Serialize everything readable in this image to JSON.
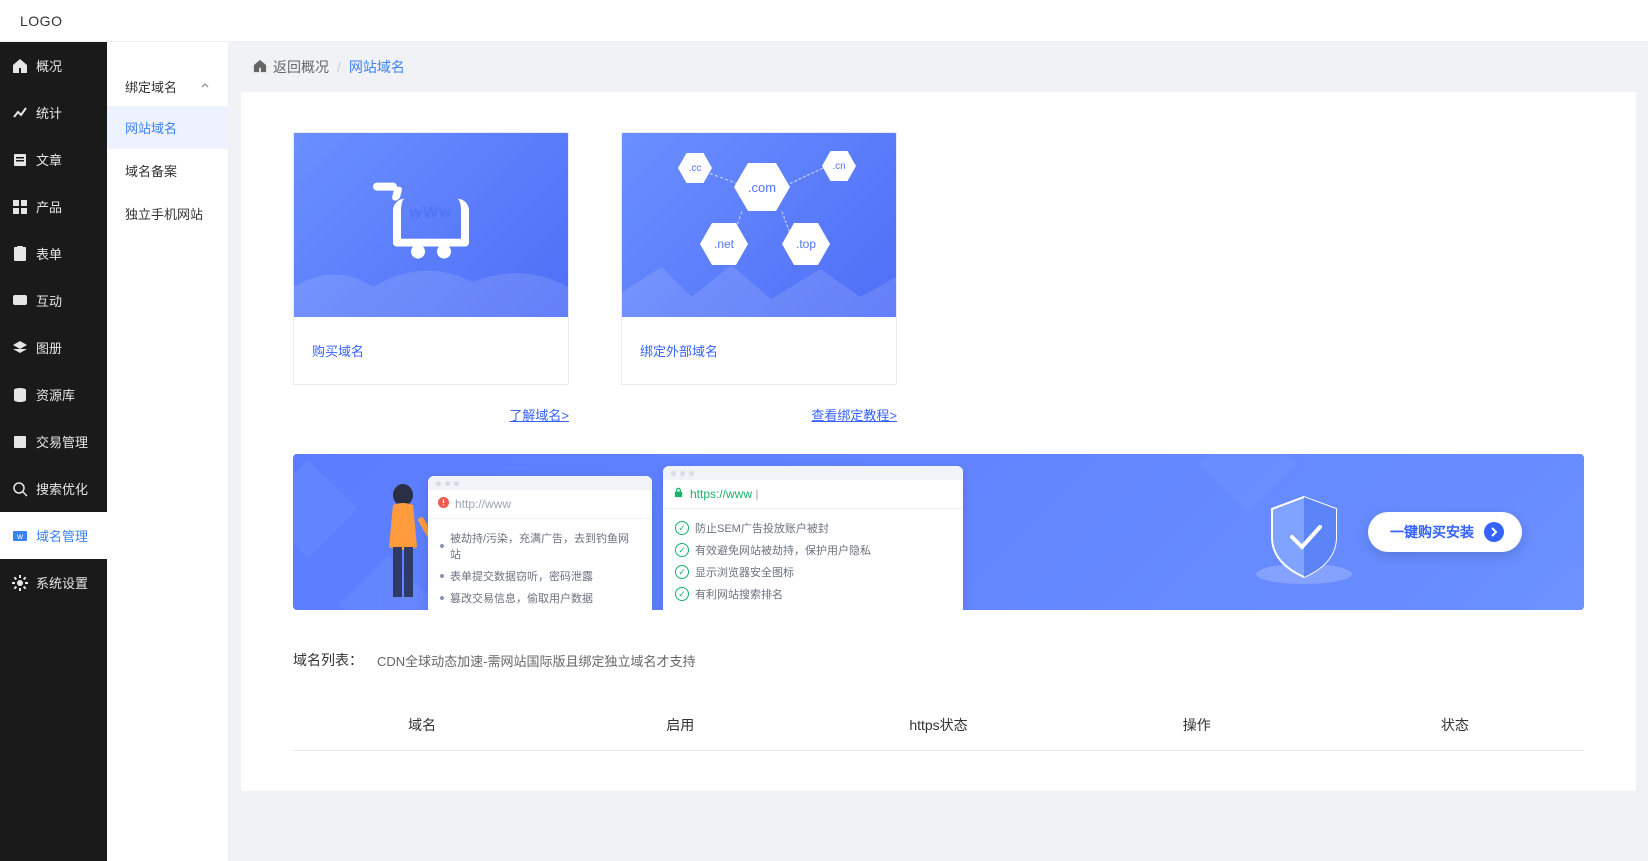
{
  "header": {
    "logo": "LOGO"
  },
  "sidebar": {
    "items": [
      {
        "label": "概况",
        "icon": "home"
      },
      {
        "label": "统计",
        "icon": "chart"
      },
      {
        "label": "文章",
        "icon": "doc"
      },
      {
        "label": "产品",
        "icon": "grid"
      },
      {
        "label": "表单",
        "icon": "form"
      },
      {
        "label": "互动",
        "icon": "chat"
      },
      {
        "label": "图册",
        "icon": "layers"
      },
      {
        "label": "资源库",
        "icon": "db"
      },
      {
        "label": "交易管理",
        "icon": "trade"
      },
      {
        "label": "搜索优化",
        "icon": "seo"
      },
      {
        "label": "域名管理",
        "icon": "domain",
        "active": true
      },
      {
        "label": "系统设置",
        "icon": "gear"
      }
    ]
  },
  "subSidebar": {
    "header": "绑定域名",
    "items": [
      {
        "label": "网站域名",
        "active": true
      },
      {
        "label": "域名备案"
      },
      {
        "label": "独立手机网站"
      }
    ]
  },
  "breadcrumb": {
    "back": "返回概况",
    "current": "网站域名"
  },
  "cards": [
    {
      "title": "购买域名",
      "link": "了解域名>",
      "art": "cart",
      "cart_text": "wWw"
    },
    {
      "title": "绑定外部域名",
      "link": "查看绑定教程>",
      "art": "hex",
      "tlds": [
        ".cc",
        ".com",
        ".cn",
        ".net",
        ".top"
      ]
    }
  ],
  "banner": {
    "http_url": "http://www",
    "https_url": "https://www",
    "bad_points": [
      "被劫持/污染，充满广告，去到钓鱼网站",
      "表单提交数据窃听，密码泄露",
      "篡改交易信息，偷取用户数据"
    ],
    "good_points": [
      "防止SEM广告投放账户被封",
      "有效避免网站被劫持，保护用户隐私",
      "显示浏览器安全图标",
      "有利网站搜索排名"
    ],
    "button": "一键购买安装"
  },
  "listSection": {
    "title": "域名列表：",
    "subtitle": "CDN全球动态加速-需网站国际版且绑定独立域名才支持",
    "columns": [
      "域名",
      "启用",
      "https状态",
      "操作",
      "状态"
    ]
  }
}
